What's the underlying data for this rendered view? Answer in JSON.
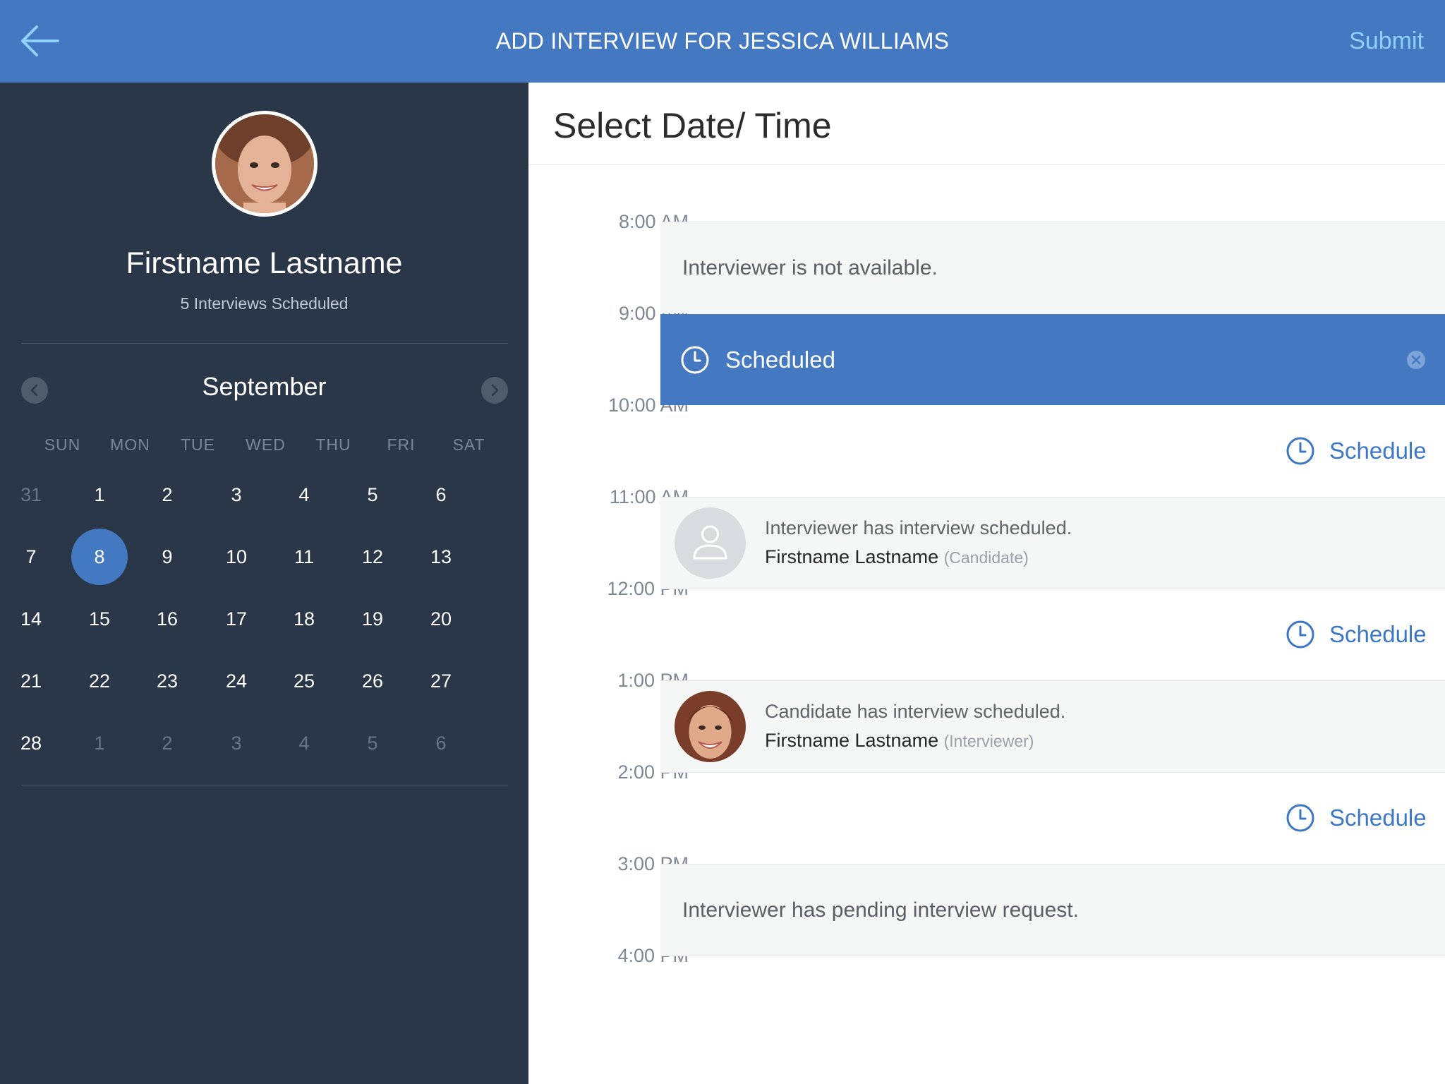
{
  "header": {
    "title": "ADD INTERVIEW FOR JESSICA WILLIAMS",
    "submit_label": "Submit",
    "back_icon": "arrow-left-icon"
  },
  "profile": {
    "name": "Firstname Lastname",
    "subtitle": "5 Interviews Scheduled"
  },
  "calendar": {
    "month": "September",
    "weekdays": [
      "SUN",
      "MON",
      "TUE",
      "WED",
      "THU",
      "FRI",
      "SAT"
    ],
    "weeks": [
      [
        "31",
        "1",
        "2",
        "3",
        "4",
        "5",
        "6"
      ],
      [
        "7",
        "8",
        "9",
        "10",
        "11",
        "12",
        "13"
      ],
      [
        "14",
        "15",
        "16",
        "17",
        "18",
        "19",
        "20"
      ],
      [
        "21",
        "22",
        "23",
        "24",
        "25",
        "26",
        "27"
      ],
      [
        "28",
        "1",
        "2",
        "3",
        "4",
        "5",
        "6"
      ]
    ],
    "selected_day": "8"
  },
  "main": {
    "title": "Select Date/ Time",
    "times": [
      "8:00 AM",
      "9:00 AM",
      "10:00 AM",
      "11:00 AM",
      "12:00 PM",
      "1:00 PM",
      "2:00 PM",
      "3:00 PM",
      "4:00 PM"
    ],
    "slots": {
      "s0": {
        "text": "Interviewer is not available."
      },
      "s1": {
        "label": "Scheduled"
      },
      "s2": {
        "label": "Schedule"
      },
      "s3": {
        "line1": "Interviewer has interview scheduled.",
        "name": "Firstname Lastname",
        "role": "(Candidate)"
      },
      "s4": {
        "label": "Schedule"
      },
      "s5": {
        "line1": "Candidate has interview scheduled.",
        "name": "Firstname Lastname",
        "role": "(Interviewer)"
      },
      "s6": {
        "label": "Schedule"
      },
      "s7": {
        "text": "Interviewer has pending interview request."
      }
    }
  },
  "colors": {
    "header": "#4479c1",
    "sidebar": "#293748",
    "accent": "#3b77c4",
    "submit": "#8fd0ff",
    "slot_gray": "#f5f6f6"
  }
}
